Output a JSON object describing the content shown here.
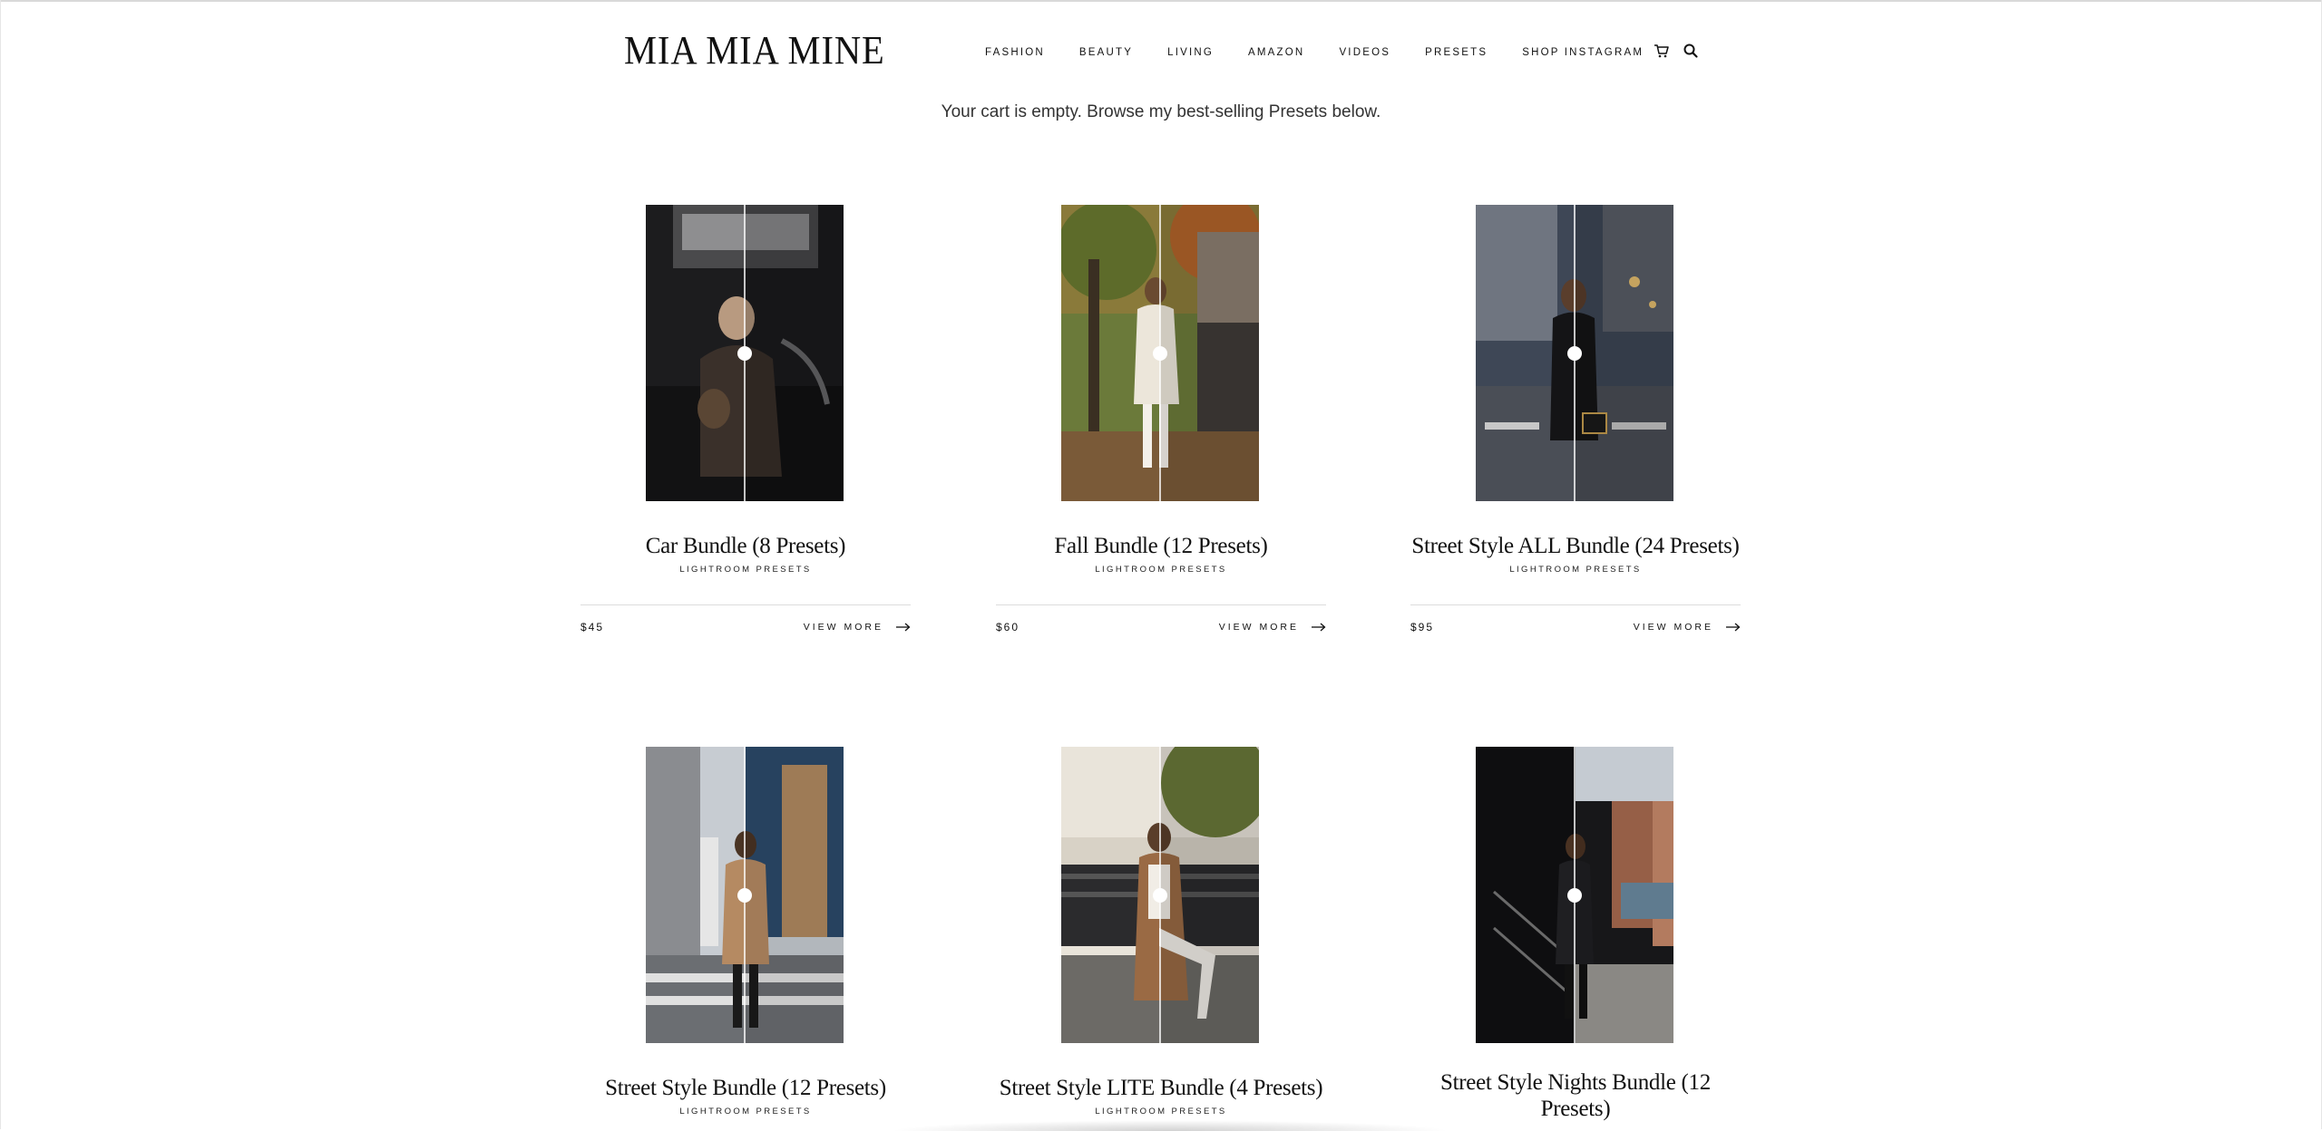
{
  "header": {
    "logo": "MIA MIA MINE",
    "nav": [
      "FASHION",
      "BEAUTY",
      "LIVING",
      "AMAZON",
      "VIDEOS",
      "PRESETS",
      "SHOP INSTAGRAM"
    ],
    "icons": [
      "cart-icon",
      "search-icon"
    ]
  },
  "cart_message": "Your cart is empty. Browse my best-selling Presets below.",
  "products": [
    {
      "title": "Car Bundle (8 Presets)",
      "subtitle": "LIGHTROOM PRESETS",
      "price": "$45",
      "action": "VIEW MORE"
    },
    {
      "title": "Fall Bundle (12 Presets)",
      "subtitle": "LIGHTROOM PRESETS",
      "price": "$60",
      "action": "VIEW MORE"
    },
    {
      "title": "Street Style ALL Bundle (24 Presets)",
      "subtitle": "LIGHTROOM PRESETS",
      "price": "$95",
      "action": "VIEW MORE"
    },
    {
      "title": "Street Style Bundle (12 Presets)",
      "subtitle": "LIGHTROOM PRESETS"
    },
    {
      "title": "Street Style LITE Bundle (4 Presets)",
      "subtitle": "LIGHTROOM PRESETS"
    },
    {
      "title": "Street Style Nights Bundle (12 Presets)"
    }
  ],
  "colors": {
    "text": "#111111",
    "rule": "#dcdcdc",
    "background": "#ffffff"
  }
}
